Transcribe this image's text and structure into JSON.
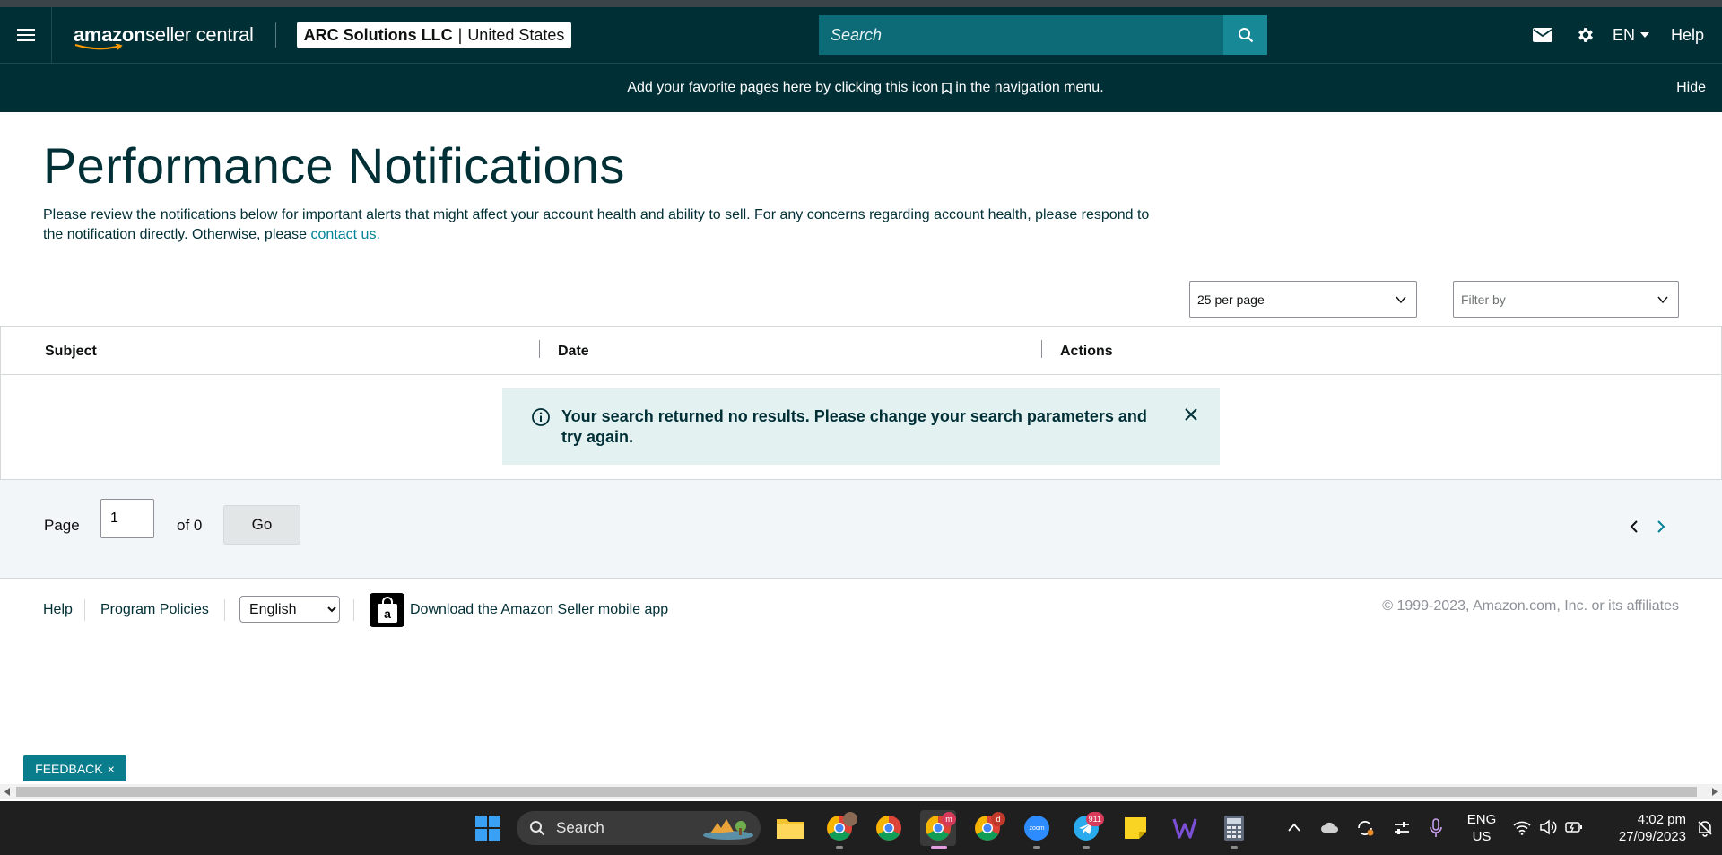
{
  "header": {
    "logo_text_bold": "amazon",
    "logo_text_light": " seller central",
    "account_name": "ARC Solutions LLC",
    "account_separator": "|",
    "marketplace": "United States",
    "search_placeholder": "Search",
    "language": "EN",
    "help": "Help"
  },
  "banner": {
    "message_before_icon": "Add your favorite pages here by clicking this icon",
    "message_after_icon": "in the navigation menu.",
    "hide": "Hide"
  },
  "main": {
    "title": "Performance Notifications",
    "description": "Please review the notifications below for important alerts that might affect your account health and ability to sell. For any concerns regarding account health, please respond to the notification directly. Otherwise, please ",
    "contact_link": "contact us.",
    "per_page": "25 per page",
    "filter_placeholder": "Filter by"
  },
  "table": {
    "columns": [
      "Subject",
      "Date",
      "Actions"
    ],
    "rows": [],
    "empty_alert": "Your search returned no results. Please change your search parameters and try again."
  },
  "pager": {
    "page_label": "Page",
    "page_value": "1",
    "of_label": "of 0",
    "go_label": "Go"
  },
  "footer": {
    "help": "Help",
    "program_policies": "Program Policies",
    "language_selected": "English",
    "language_options": [
      "English"
    ],
    "app_download": "Download the Amazon Seller mobile app",
    "copyright": "© 1999-2023, Amazon.com, Inc. or its affiliates"
  },
  "feedback": {
    "label": "FEEDBACK",
    "close": "×"
  },
  "taskbar": {
    "search_label": "Search",
    "telegram_badge": "911",
    "chrome_profile_badge_1": "m",
    "chrome_profile_badge_2": "d",
    "lang_line1": "ENG",
    "lang_line2": "US",
    "time": "4:02 pm",
    "date": "27/09/2023",
    "zoom_label": "zoom"
  },
  "colors": {
    "header_bg": "#002f36",
    "search_bg": "#0d6b77",
    "search_btn": "#168896",
    "link": "#008296",
    "alert_bg": "#e3f1f1",
    "feedback_bg": "#0a7d8c"
  }
}
